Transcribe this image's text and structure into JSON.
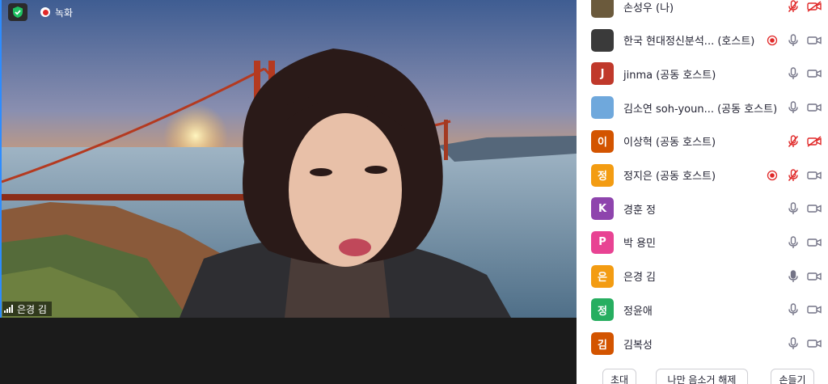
{
  "recording": {
    "label": "녹화"
  },
  "video": {
    "speaker_name": "은경 김"
  },
  "participants": [
    {
      "avatar_text": "",
      "avatar_color": "#6b5a3c",
      "name": "손성우 (나)",
      "record": false,
      "mic": "muted",
      "cam": "off"
    },
    {
      "avatar_text": "",
      "avatar_color": "#3a3a3a",
      "name": "한국 현대정신분석... (호스트)",
      "record": true,
      "mic": "on",
      "cam": "on"
    },
    {
      "avatar_text": "J",
      "avatar_color": "#c0392b",
      "name": "jinma (공동 호스트)",
      "record": false,
      "mic": "on",
      "cam": "on"
    },
    {
      "avatar_text": "",
      "avatar_color": "#6fa8dc",
      "name": "김소연 soh-youn... (공동 호스트)",
      "record": false,
      "mic": "on",
      "cam": "on"
    },
    {
      "avatar_text": "이",
      "avatar_color": "#d35400",
      "name": "이상혁 (공동 호스트)",
      "record": false,
      "mic": "muted",
      "cam": "off"
    },
    {
      "avatar_text": "정",
      "avatar_color": "#f39c12",
      "name": "정지은 (공동 호스트)",
      "record": true,
      "mic": "muted",
      "cam": "on"
    },
    {
      "avatar_text": "K",
      "avatar_color": "#8e44ad",
      "name": "경훈 정",
      "record": false,
      "mic": "on",
      "cam": "on"
    },
    {
      "avatar_text": "P",
      "avatar_color": "#e84393",
      "name": "박 용민",
      "record": false,
      "mic": "on",
      "cam": "on"
    },
    {
      "avatar_text": "은",
      "avatar_color": "#f39c12",
      "name": "은경 김",
      "record": false,
      "mic": "speaking",
      "cam": "on"
    },
    {
      "avatar_text": "정",
      "avatar_color": "#27ae60",
      "name": "정윤애",
      "record": false,
      "mic": "on",
      "cam": "on"
    },
    {
      "avatar_text": "김",
      "avatar_color": "#d35400",
      "name": "김복성",
      "record": false,
      "mic": "on",
      "cam": "on"
    }
  ],
  "buttons": {
    "invite": "초대",
    "unmute_me": "나만 음소거 해제",
    "raise_hand": "손들기"
  },
  "colors": {
    "accent": "#2d8cff",
    "muted": "#e02828",
    "icon": "#747487"
  }
}
